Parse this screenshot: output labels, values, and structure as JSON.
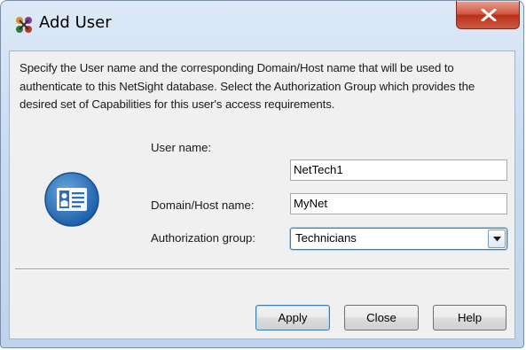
{
  "window": {
    "title": "Add User",
    "app_icon": "netsight-app-icon",
    "close_icon": "close-x-icon"
  },
  "description": "Specify the User name and the corresponding Domain/Host name that will be used to authenticate to this NetSight database.  Select the Authorization Group which provides the desired set of Capabilities for this user's access requirements.",
  "form": {
    "user_icon": "user-card-icon",
    "user_name": {
      "label": "User name:",
      "value": "NetTech1"
    },
    "domain_host": {
      "label": "Domain/Host name:",
      "value": "MyNet"
    },
    "authorization_group": {
      "label": "Authorization group:",
      "value": "Technicians",
      "dropdown_icon": "chevron-down-icon"
    }
  },
  "buttons": {
    "apply": "Apply",
    "close": "Close",
    "help": "Help"
  },
  "colors": {
    "title_bar": "#c8dbf1",
    "close_button": "#c9432d",
    "focus_border": "#3c7fb1",
    "client_bg": "#f0f0f0"
  }
}
